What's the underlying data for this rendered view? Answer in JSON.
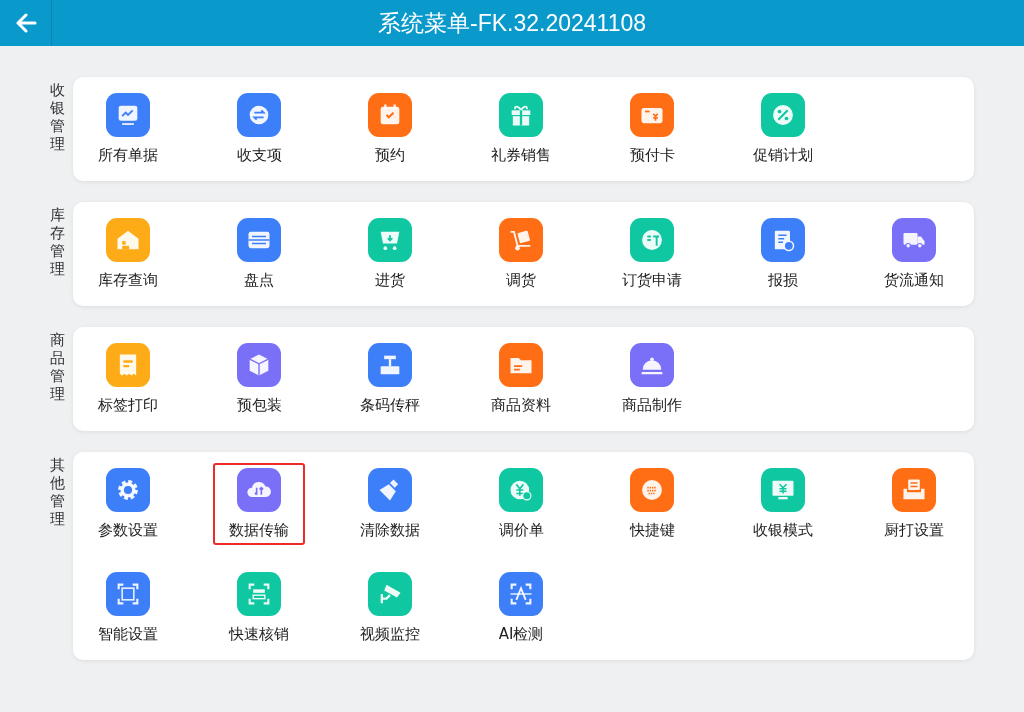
{
  "header": {
    "title": "系统菜单-FK.32.20241108"
  },
  "sections": [
    {
      "label": "收银管理",
      "items": [
        {
          "label": "所有单据",
          "kind": "chart",
          "color": "#3d7ff9",
          "selected": false
        },
        {
          "label": "收支项",
          "kind": "exchange",
          "color": "#3d7ff9",
          "selected": false
        },
        {
          "label": "预约",
          "kind": "calendar",
          "color": "#ff6e14",
          "selected": false
        },
        {
          "label": "礼券销售",
          "kind": "gift",
          "color": "#0fc7a0",
          "selected": false
        },
        {
          "label": "预付卡",
          "kind": "card",
          "color": "#ff6e14",
          "selected": false
        },
        {
          "label": "促销计划",
          "kind": "percent",
          "color": "#0fc7a0",
          "selected": false
        }
      ]
    },
    {
      "label": "库存管理",
      "items": [
        {
          "label": "库存查询",
          "kind": "house",
          "color": "#fdab16",
          "selected": false
        },
        {
          "label": "盘点",
          "kind": "abacus",
          "color": "#3d7ff9",
          "selected": false
        },
        {
          "label": "进货",
          "kind": "cart",
          "color": "#0fc7a0",
          "selected": false
        },
        {
          "label": "调货",
          "kind": "trolley",
          "color": "#ff6e14",
          "selected": false
        },
        {
          "label": "订货申请",
          "kind": "order",
          "color": "#0fc7a0",
          "selected": false
        },
        {
          "label": "报损",
          "kind": "report",
          "color": "#3d7ff9",
          "selected": false
        },
        {
          "label": "货流通知",
          "kind": "truck",
          "color": "#7a70f7",
          "selected": false
        }
      ]
    },
    {
      "label": "商品管理",
      "items": [
        {
          "label": "标签打印",
          "kind": "receipt",
          "color": "#fdab16",
          "selected": false
        },
        {
          "label": "预包装",
          "kind": "box",
          "color": "#7a70f7",
          "selected": false
        },
        {
          "label": "条码传秤",
          "kind": "scale",
          "color": "#3d7ff9",
          "selected": false
        },
        {
          "label": "商品资料",
          "kind": "folder",
          "color": "#ff6e14",
          "selected": false
        },
        {
          "label": "商品制作",
          "kind": "cloche",
          "color": "#7a70f7",
          "selected": false
        }
      ]
    },
    {
      "label": "其他管理",
      "items": [
        {
          "label": "参数设置",
          "kind": "gear",
          "color": "#3d7ff9",
          "selected": false
        },
        {
          "label": "数据传输",
          "kind": "cloud",
          "color": "#7a70f7",
          "selected": true
        },
        {
          "label": "清除数据",
          "kind": "broom",
          "color": "#3d7ff9",
          "selected": false
        },
        {
          "label": "调价单",
          "kind": "coin",
          "color": "#0fc7a0",
          "selected": false
        },
        {
          "label": "快捷键",
          "kind": "keyboard",
          "color": "#ff6e14",
          "selected": false
        },
        {
          "label": "收银模式",
          "kind": "monitor",
          "color": "#0fc7a0",
          "selected": false
        },
        {
          "label": "厨打设置",
          "kind": "printer",
          "color": "#ff6e14",
          "selected": false
        },
        {
          "label": "智能设置",
          "kind": "aiframe",
          "color": "#3d7ff9",
          "selected": false
        },
        {
          "label": "快速核销",
          "kind": "scan",
          "color": "#0fc7a0",
          "selected": false
        },
        {
          "label": "视频监控",
          "kind": "camera",
          "color": "#0fc7a0",
          "selected": false
        },
        {
          "label": "AI检测",
          "kind": "aiscan",
          "color": "#3d7ff9",
          "selected": false
        }
      ]
    }
  ]
}
